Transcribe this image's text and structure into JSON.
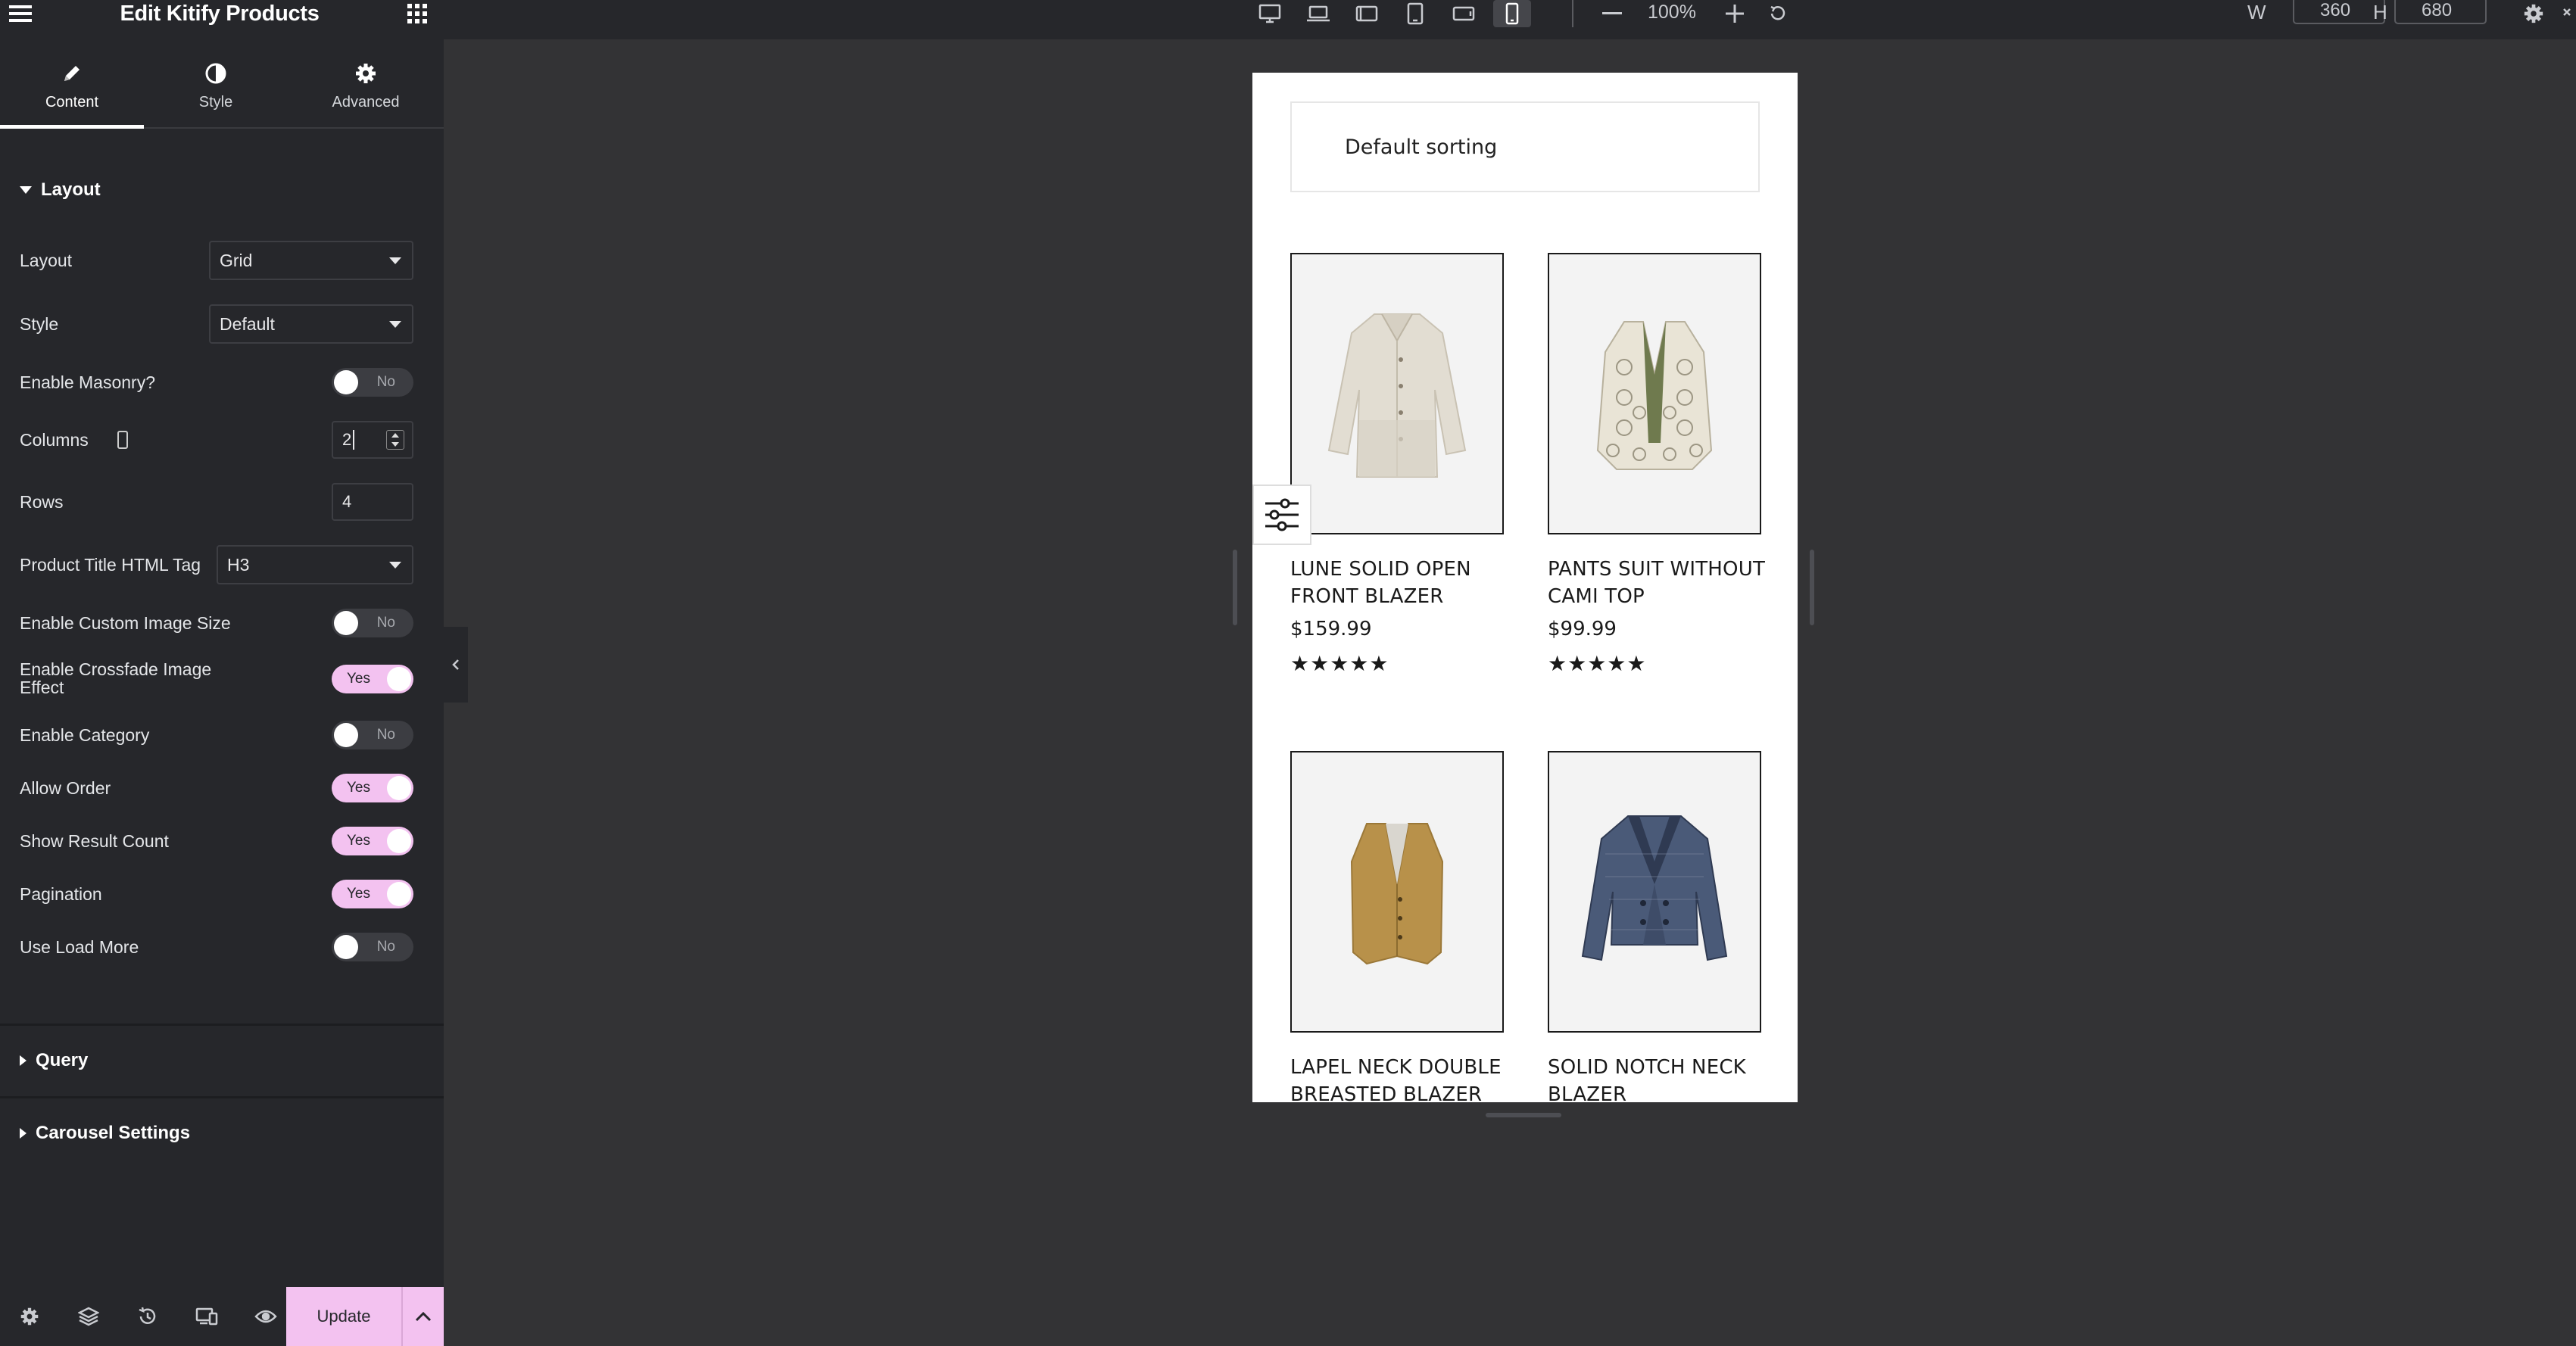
{
  "panel": {
    "title": "Edit Kitify Products",
    "tabs": [
      {
        "label": "Content",
        "icon": "pencil-icon",
        "active": true
      },
      {
        "label": "Style",
        "icon": "half-circle-icon",
        "active": false
      },
      {
        "label": "Advanced",
        "icon": "gear-icon",
        "active": false
      }
    ],
    "layout_section": "Layout",
    "controls": {
      "layout": {
        "label": "Layout",
        "value": "Grid"
      },
      "style": {
        "label": "Style",
        "value": "Default"
      },
      "masonry": {
        "label": "Enable Masonry?",
        "state": "No"
      },
      "columns": {
        "label": "Columns",
        "value": "2"
      },
      "rows": {
        "label": "Rows",
        "value": "4"
      },
      "title_tag": {
        "label": "Product Title HTML Tag",
        "value": "H3"
      },
      "custom_image_size": {
        "label": "Enable Custom Image Size",
        "state": "No"
      },
      "crossfade_line1": "Enable Crossfade Image",
      "crossfade_line2": "Effect",
      "crossfade_state": "Yes",
      "category": {
        "label": "Enable Category",
        "state": "No"
      },
      "allow_order": {
        "label": "Allow Order",
        "state": "Yes"
      },
      "result_count": {
        "label": "Show Result Count",
        "state": "Yes"
      },
      "pagination": {
        "label": "Pagination",
        "state": "Yes"
      },
      "load_more": {
        "label": "Use Load More",
        "state": "No"
      }
    },
    "query_section": "Query",
    "carousel_section": "Carousel Settings",
    "footer": {
      "update_label": "Update"
    }
  },
  "topbar": {
    "zoom": "100%",
    "w_label": "W",
    "w_value": "360",
    "h_label": "H",
    "h_value": "680",
    "active_device": "mobile-portrait"
  },
  "preview": {
    "sorting": "Default sorting",
    "products": [
      {
        "title": "LUNE SOLID OPEN FRONT BLAZER",
        "price": "$159.99",
        "rating": "★★★★★",
        "image": "trench-coat"
      },
      {
        "title": "PANTS SUIT WITHOUT CAMI TOP",
        "price": "$99.99",
        "rating": "★★★★★",
        "image": "crochet-vest"
      },
      {
        "title": "LAPEL NECK DOUBLE BREASTED BLAZER",
        "price": "",
        "rating": "",
        "image": "mustard-vest"
      },
      {
        "title": "SOLID NOTCH NECK BLAZER",
        "price": "",
        "rating": "",
        "image": "tweed-jacket"
      }
    ]
  },
  "colors": {
    "accent": "#f3c2f0",
    "panel_bg": "#26272b",
    "canvas_bg": "#333335"
  }
}
